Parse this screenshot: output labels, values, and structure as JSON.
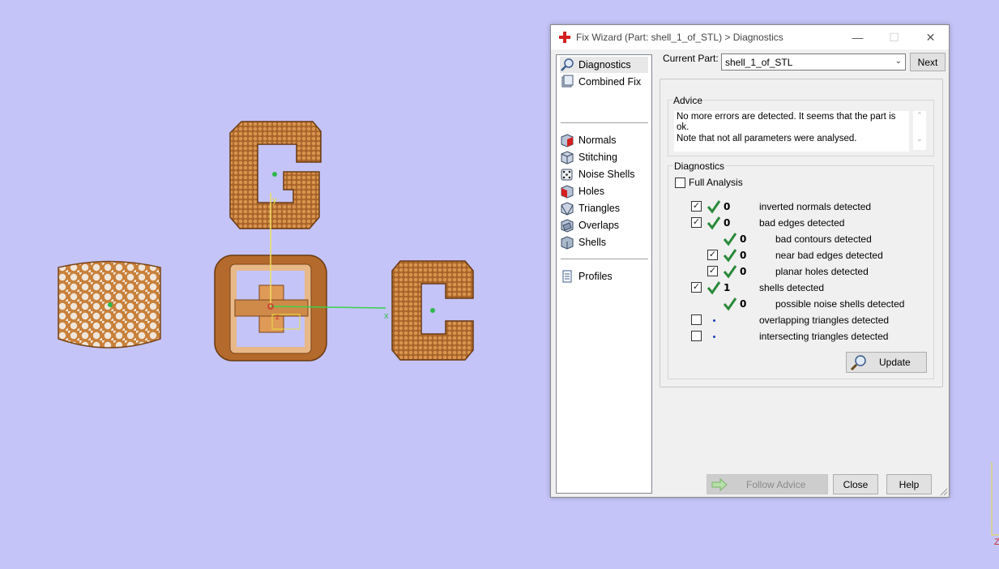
{
  "viewport": {
    "background": "#c4c4f8",
    "axis_y_label": "y",
    "axis_x_label": "x",
    "axis_z_label": "z",
    "corner_axis_label": "Z",
    "model_color": "#c8803a"
  },
  "dialog": {
    "title": "Fix Wizard (Part: shell_1_of_STL) > Diagnostics",
    "window_buttons": {
      "minimize": "—",
      "maximize": "☐",
      "close": "✕"
    },
    "nav": {
      "items": [
        {
          "label": "Diagnostics",
          "icon": "magnifier-icon"
        },
        {
          "label": "Combined Fix",
          "icon": "combined-fix-icon"
        },
        {
          "label": "Normals",
          "icon": "normals-cube-icon"
        },
        {
          "label": "Stitching",
          "icon": "stitching-cube-icon"
        },
        {
          "label": "Noise Shells",
          "icon": "noise-shells-dice-icon"
        },
        {
          "label": "Holes",
          "icon": "holes-cube-icon"
        },
        {
          "label": "Triangles",
          "icon": "triangles-cube-icon"
        },
        {
          "label": "Overlaps",
          "icon": "overlaps-cube-icon"
        },
        {
          "label": "Shells",
          "icon": "shells-cube-icon"
        },
        {
          "label": "Profiles",
          "icon": "profile-document-icon"
        }
      ]
    },
    "current_part_label": "Current Part:",
    "current_part_value": "shell_1_of_STL",
    "next_label": "Next",
    "advice": {
      "legend": "Advice",
      "line1": "No more errors are detected. It seems that the part is ok.",
      "line2": "Note that not all parameters were analysed."
    },
    "diagnostics": {
      "legend": "Diagnostics",
      "full_analysis_label": "Full Analysis",
      "rows": [
        {
          "count": "0",
          "label": "inverted normals detected"
        },
        {
          "count": "0",
          "label": "bad edges detected"
        },
        {
          "count": "0",
          "label": "bad contours detected"
        },
        {
          "count": "0",
          "label": "near bad edges detected"
        },
        {
          "count": "0",
          "label": "planar holes detected"
        },
        {
          "count": "1",
          "label": "shells detected"
        },
        {
          "count": "0",
          "label": "possible noise shells detected"
        },
        {
          "count": "",
          "label": "overlapping triangles detected"
        },
        {
          "count": "",
          "label": "intersecting triangles detected"
        }
      ]
    },
    "update_label": "Update",
    "follow_advice_label": "Follow Advice",
    "close_label": "Close",
    "help_label": "Help",
    "accent_check_color": "#2a8a3a"
  }
}
